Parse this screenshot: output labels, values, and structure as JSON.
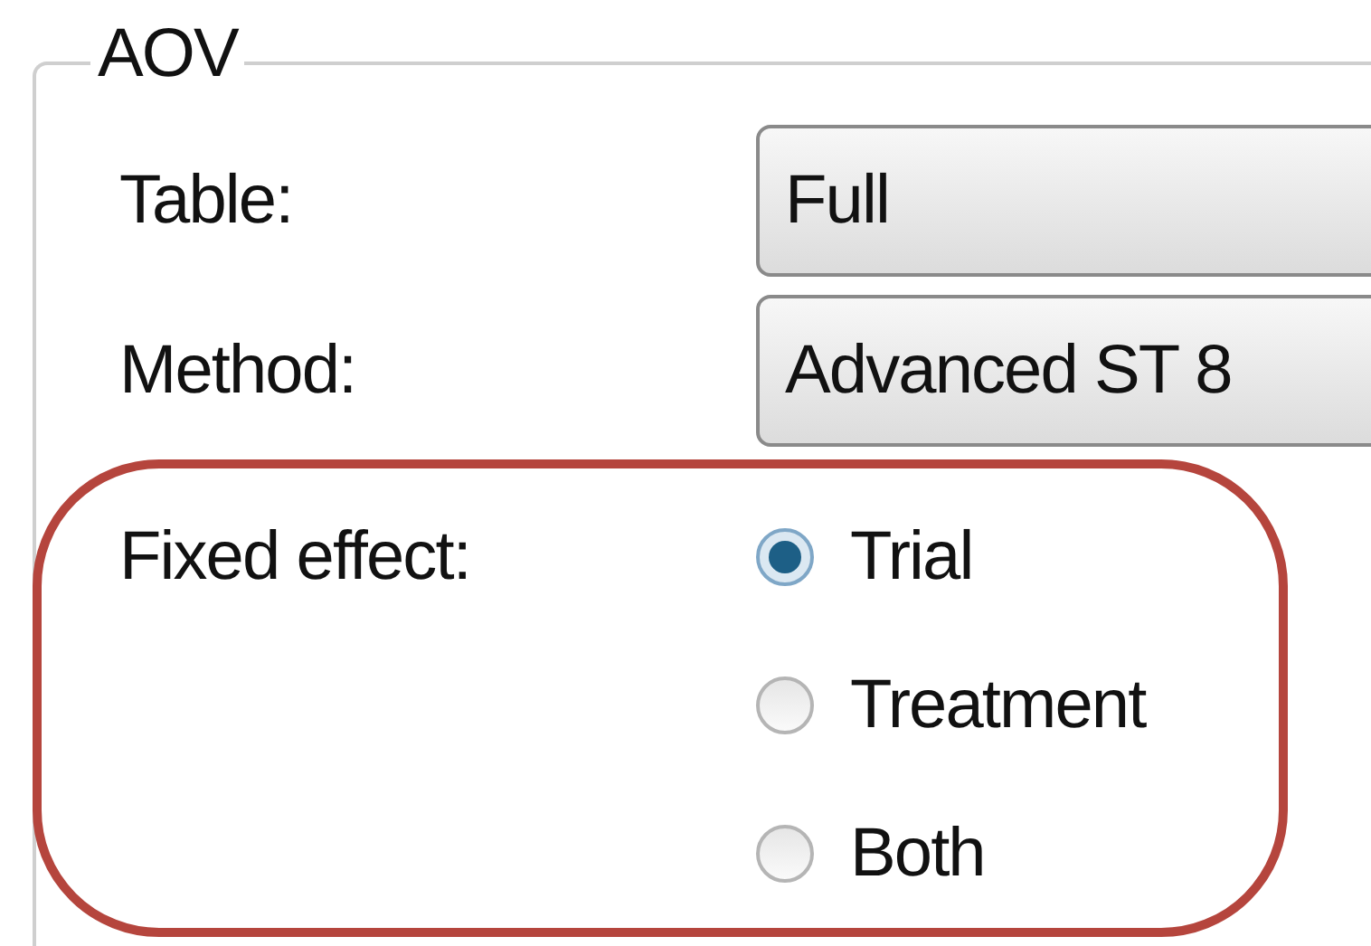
{
  "group": {
    "title": "AOV",
    "fields": [
      {
        "label": "Table:",
        "value": "Full"
      },
      {
        "label": "Method:",
        "value": "Advanced ST 8"
      }
    ],
    "fixed_effect": {
      "label": "Fixed effect:",
      "options": [
        {
          "label": "Trial",
          "selected": true
        },
        {
          "label": "Treatment",
          "selected": false
        },
        {
          "label": "Both",
          "selected": false
        }
      ]
    }
  }
}
